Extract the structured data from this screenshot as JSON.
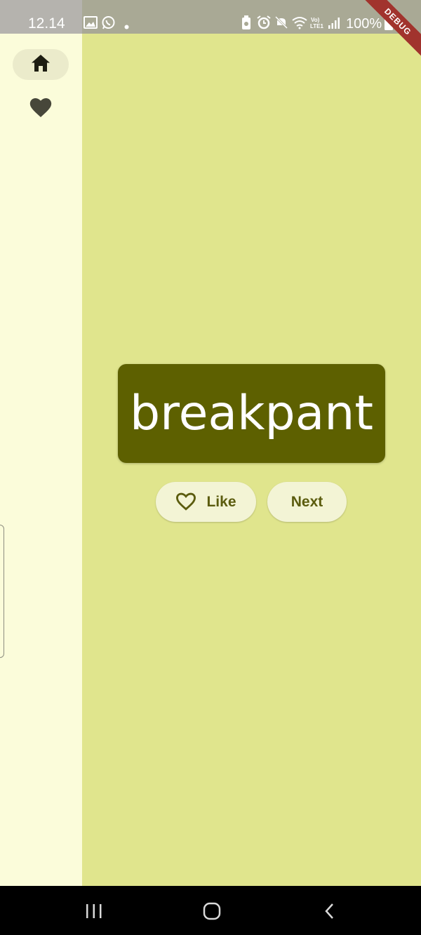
{
  "status_bar": {
    "time": "12.14",
    "battery": "100%"
  },
  "debug_banner": "DEBUG",
  "nav_rail": {
    "items": [
      {
        "name": "home",
        "icon": "home-icon",
        "selected": true
      },
      {
        "name": "favorites",
        "icon": "heart-icon",
        "selected": false
      }
    ]
  },
  "main": {
    "word": "breakpant",
    "like_label": "Like",
    "next_label": "Next"
  },
  "colors": {
    "background": "#e0e58d",
    "rail": "#fbfcda",
    "card": "#5d6000",
    "button": "#f3f4d5",
    "button_text": "#5b5c0e"
  }
}
